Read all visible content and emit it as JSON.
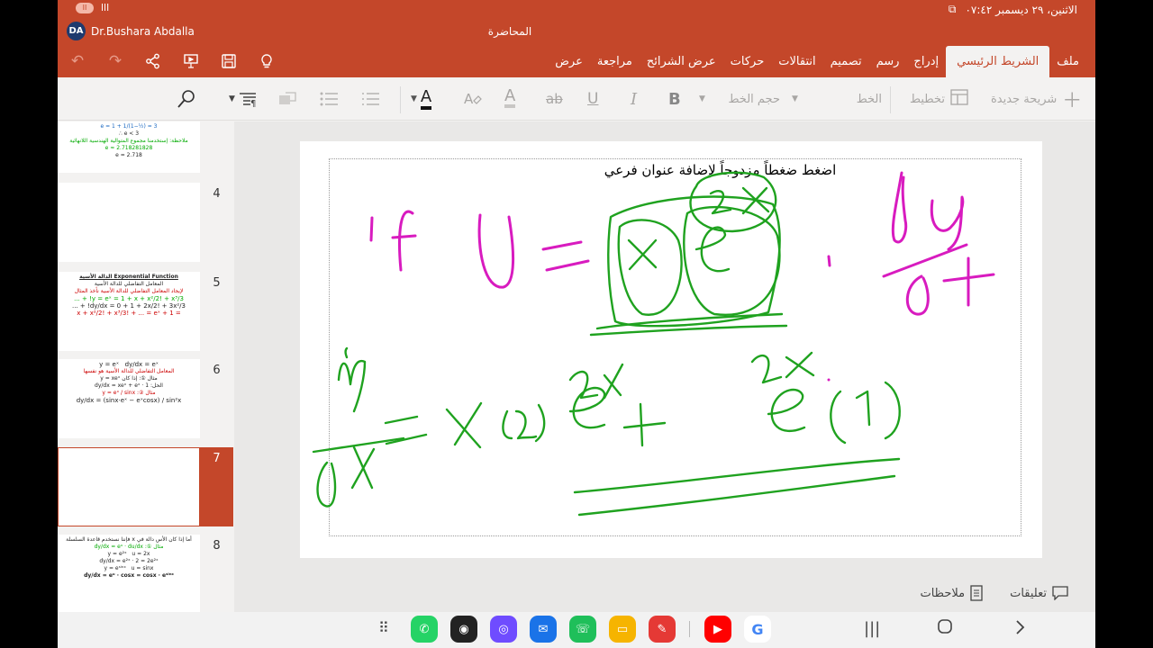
{
  "status": {
    "rec_badge": "II",
    "signal": "lll",
    "datetime": "الاثنين، ٢٩ ديسمبر ٠٧:٤٢",
    "screen_icon": "⧉"
  },
  "user": {
    "initials": "DA",
    "name": "Dr.Bushara Abdalla"
  },
  "document": {
    "title": "المحاضرة"
  },
  "tabs": [
    {
      "label": "ملف"
    },
    {
      "label": "الشريط الرئيسي",
      "active": true
    },
    {
      "label": "إدراج"
    },
    {
      "label": "رسم"
    },
    {
      "label": "تصميم"
    },
    {
      "label": "انتقالات"
    },
    {
      "label": "حركات"
    },
    {
      "label": "عرض الشرائح"
    },
    {
      "label": "مراجعة"
    },
    {
      "label": "عرض"
    }
  ],
  "ribbon": {
    "new_slide": "شريحة جديدة",
    "layout": "تخطيط",
    "font_name": "الخط",
    "font_size": "حجم الخط",
    "bold": "B",
    "italic": "I",
    "underline": "U",
    "strike": "ab",
    "font_color": "A"
  },
  "thumbnails": [
    {
      "number": "4"
    },
    {
      "number": "5"
    },
    {
      "number": "6"
    },
    {
      "number": "7",
      "selected": true
    },
    {
      "number": "8"
    }
  ],
  "slide": {
    "subtitle_placeholder": "اضغط ضغطاً مزدوجاً لإضافة عنوان فرعي"
  },
  "bottom": {
    "comments": "تعليقات",
    "notes": "ملاحظات"
  },
  "apps": [
    {
      "name": "whatsapp-app",
      "color": "#25d366",
      "glyph": "✆"
    },
    {
      "name": "camera-app",
      "color": "#222222",
      "glyph": "◉"
    },
    {
      "name": "browser-app",
      "color": "#6f4cff",
      "glyph": "◎"
    },
    {
      "name": "messages-app",
      "color": "#1a73e8",
      "glyph": "✉"
    },
    {
      "name": "phone-app",
      "color": "#1fbf5a",
      "glyph": "☏"
    },
    {
      "name": "files-app",
      "color": "#f6b400",
      "glyph": "▭"
    },
    {
      "name": "notes-app",
      "color": "#e53935",
      "glyph": "✎"
    },
    {
      "name": "youtube-app",
      "color": "#ff0000",
      "glyph": "▶"
    },
    {
      "name": "google-app",
      "color": "#ffffff",
      "glyph": "G"
    }
  ]
}
